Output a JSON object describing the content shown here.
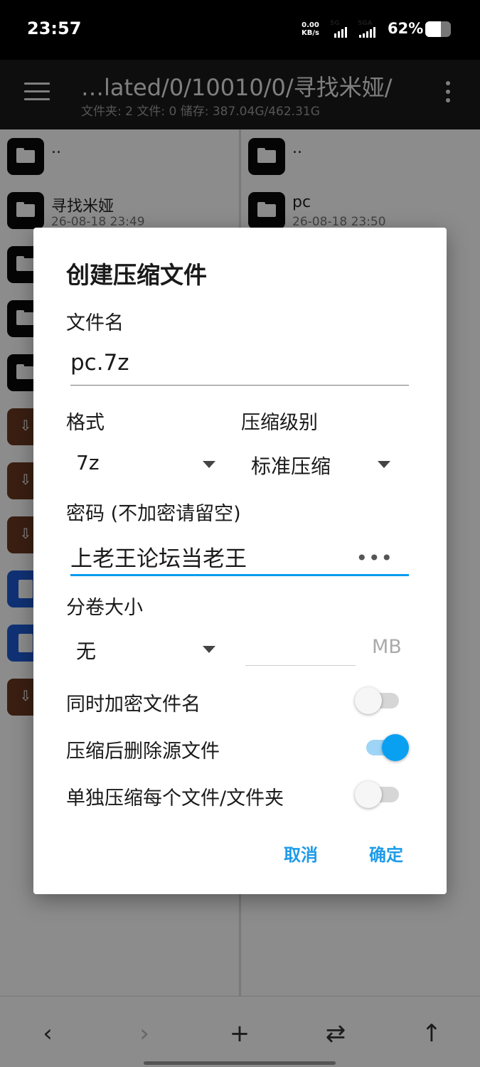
{
  "status_bar": {
    "time": "23:57",
    "net_speed": "0.00",
    "net_unit": "KB/s",
    "sim1": "5G",
    "sim2": "5GA",
    "battery_pct": "62%",
    "battery_level": 0.62
  },
  "app_bar": {
    "path": "…lated/0/10010/0/寻找米娅/",
    "subtitle": "文件夹: 2  文件: 0  储存: 387.04G/462.31G"
  },
  "left_pane": {
    "items": [
      {
        "name": "..",
        "date": "",
        "type": "folder"
      },
      {
        "name": "寻找米娅",
        "date": "26-08-18 23:49",
        "type": "folder"
      },
      {
        "name": "",
        "date": "",
        "type": "folder"
      },
      {
        "name": "",
        "date": "",
        "type": "folder"
      },
      {
        "name": "",
        "date": "",
        "type": "folder"
      },
      {
        "name": "",
        "date": "",
        "type": "archive"
      },
      {
        "name": "",
        "date": "",
        "type": "archive"
      },
      {
        "name": "",
        "date": "",
        "type": "archive"
      },
      {
        "name": "",
        "date": "",
        "type": "doc"
      },
      {
        "name": "",
        "date": "",
        "type": "doc"
      },
      {
        "name": "",
        "date": "",
        "type": "archive"
      }
    ]
  },
  "right_pane": {
    "items": [
      {
        "name": "..",
        "date": "",
        "type": "folder"
      },
      {
        "name": "pc",
        "date": "26-08-18 23:50",
        "type": "folder"
      }
    ]
  },
  "dialog": {
    "title": "创建压缩文件",
    "filename_label": "文件名",
    "filename_value": "pc.7z",
    "format_label": "格式",
    "format_value": "7z",
    "level_label": "压缩级别",
    "level_value": "标准压缩",
    "password_label": "密码 (不加密请留空)",
    "password_value": "上老王论坛当老王",
    "split_label": "分卷大小",
    "split_value": "无",
    "split_size_value": "",
    "split_unit": "MB",
    "encrypt_names_label": "同时加密文件名",
    "encrypt_names_on": false,
    "delete_source_label": "压缩后删除源文件",
    "delete_source_on": true,
    "each_separately_label": "单独压缩每个文件/文件夹",
    "each_separately_on": false,
    "cancel": "取消",
    "ok": "确定"
  },
  "colors": {
    "accent": "#1e9be8",
    "toggle_on": "#0aa0f2"
  }
}
